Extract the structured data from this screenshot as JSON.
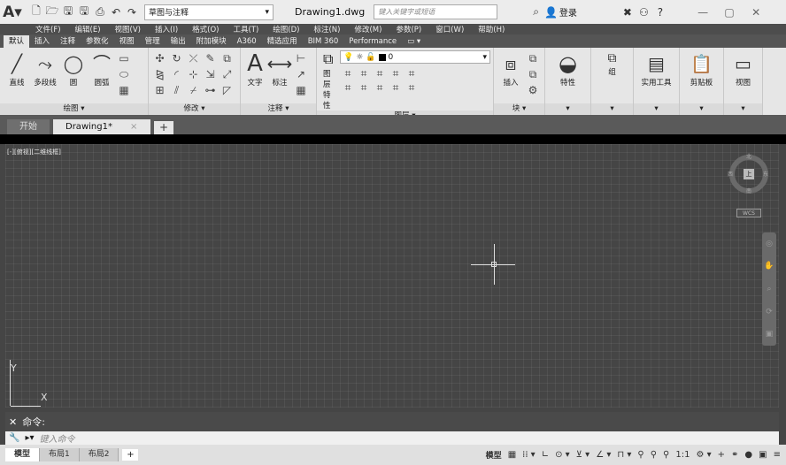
{
  "titlebar": {
    "workspace": "草图与注释",
    "document_title": "Drawing1.dwg",
    "search_placeholder": "键入关键字或短语",
    "login": "登录"
  },
  "menu": [
    "文件(F)",
    "编辑(E)",
    "视图(V)",
    "插入(I)",
    "格式(O)",
    "工具(T)",
    "绘图(D)",
    "标注(N)",
    "修改(M)",
    "参数(P)",
    "窗口(W)",
    "帮助(H)"
  ],
  "ribbon_tabs": [
    "默认",
    "插入",
    "注释",
    "参数化",
    "视图",
    "管理",
    "输出",
    "附加模块",
    "A360",
    "精选应用",
    "BIM 360",
    "Performance"
  ],
  "panels": {
    "draw": {
      "title": "绘图 ▾",
      "buttons": [
        "直线",
        "多段线",
        "圆",
        "圆弧"
      ]
    },
    "modify": {
      "title": "修改 ▾"
    },
    "annotation": {
      "title": "注释 ▾",
      "buttons": [
        "文字",
        "标注"
      ]
    },
    "layers": {
      "title": "图层 ▾",
      "layer_value": "0",
      "labels": [
        "图层",
        "特性"
      ]
    },
    "block": {
      "title": "块 ▾",
      "buttons": [
        "插入"
      ]
    },
    "properties": {
      "buttons": [
        "特性"
      ]
    },
    "groups": {
      "buttons": [
        "组"
      ]
    },
    "utilities": {
      "buttons": [
        "实用工具"
      ]
    },
    "clipboard": {
      "buttons": [
        "剪贴板"
      ]
    },
    "view": {
      "buttons": [
        "视图"
      ]
    }
  },
  "doc_tabs": {
    "start": "开始",
    "drawing": "Drawing1*",
    "close": "×",
    "plus": "+"
  },
  "canvas": {
    "viewport_label": "[-][俯视][二维线框]",
    "ucs_y": "Y",
    "ucs_x": "X",
    "viewcube_top": "上",
    "viewcube_n": "北",
    "viewcube_s": "南",
    "viewcube_w": "西",
    "viewcube_e": "东",
    "wcs": "WCS"
  },
  "command": {
    "history": "命令:",
    "placeholder": "键入命令"
  },
  "layout_tabs": [
    "模型",
    "布局1",
    "布局2"
  ],
  "status": {
    "model": "模型",
    "scale": "1:1"
  }
}
